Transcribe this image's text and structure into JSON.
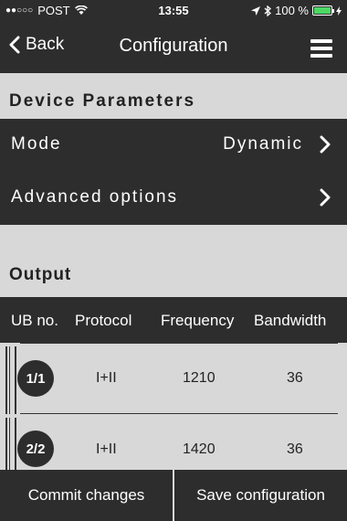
{
  "status_bar": {
    "carrier_dots": "●●○○○",
    "carrier": "POST",
    "wifi_icon": "wifi-icon",
    "time": "13:55",
    "location_icon": "location-arrow-icon",
    "bluetooth_icon": "bluetooth-icon",
    "battery": "100 %",
    "battery_level": 1.0,
    "charging_icon": "lightning-icon"
  },
  "nav": {
    "back_label": "Back",
    "title": "Configuration",
    "menu_icon": "hamburger-menu-icon"
  },
  "device_parameters": {
    "header": "Device Parameters",
    "mode_label": "Mode",
    "mode_value": "Dynamic",
    "advanced_label": "Advanced options"
  },
  "output": {
    "header": "Output",
    "columns": [
      "UB no.",
      "Protocol",
      "Frequency",
      "Bandwidth"
    ],
    "rows": [
      {
        "ub": "1/1",
        "protocol": "I+II",
        "frequency": "1210",
        "bandwidth": "36"
      },
      {
        "ub": "2/2",
        "protocol": "I+II",
        "frequency": "1420",
        "bandwidth": "36"
      }
    ]
  },
  "bottom_bar": {
    "commit_label": "Commit changes",
    "save_label": "Save configuration"
  },
  "colors": {
    "dark": "#2d2d2d",
    "light": "#d8d8d8",
    "battery": "#4cd964"
  }
}
